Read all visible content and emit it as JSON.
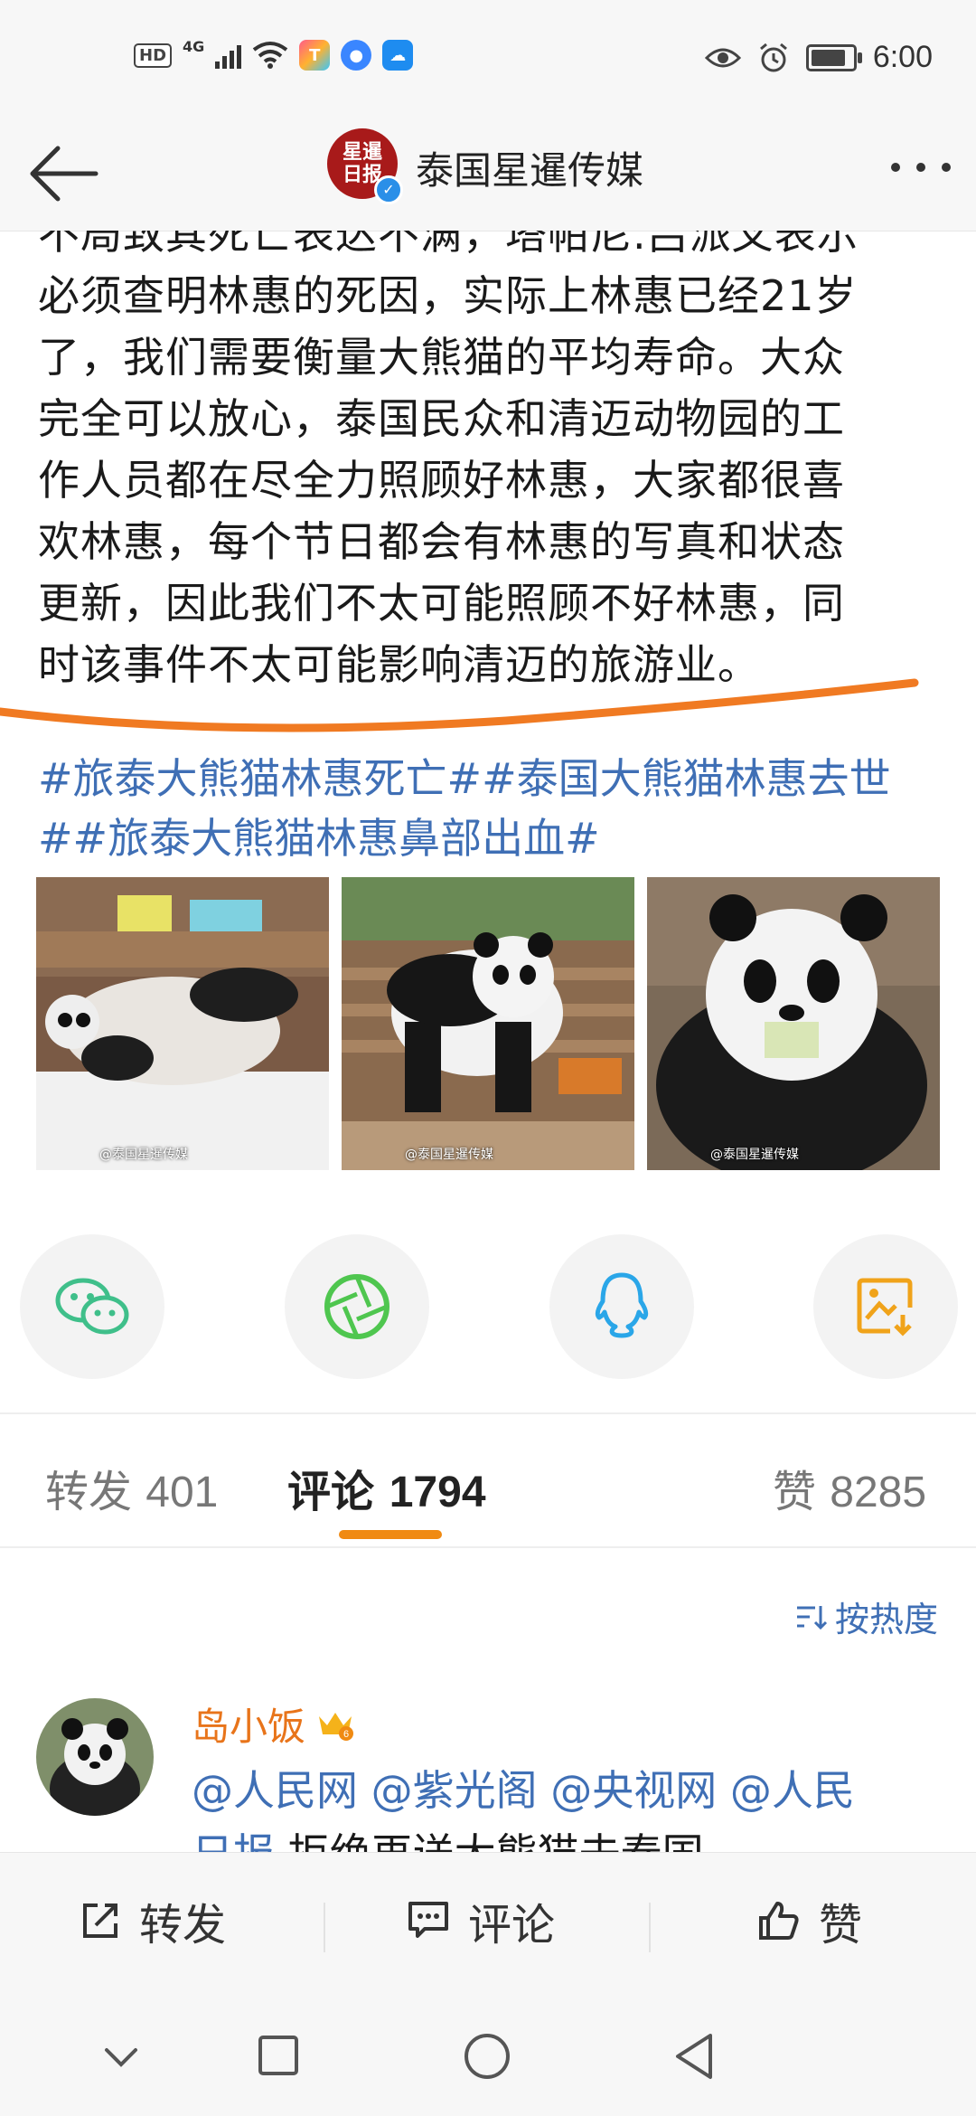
{
  "status_bar": {
    "hd_label": "HD",
    "network_label": "4G",
    "time": "6:00",
    "battery_level_pct": 85,
    "icons": [
      "signal-icon",
      "wifi-icon",
      "app-notification-icon",
      "browser-icon",
      "weather-icon",
      "eye-icon",
      "alarm-icon",
      "battery-icon"
    ]
  },
  "header": {
    "account_name": "泰国星暹传媒",
    "logo_text": "星暹日报",
    "icons": [
      "back-arrow-icon",
      "verified-icon",
      "more-icon"
    ]
  },
  "post": {
    "lines": [
      "不局致其死亡表达不满，塔帕尼.吕派叉表示",
      "必须查明林惠的死因，实际上林惠已经21岁",
      "了，我们需要衡量大熊猫的平均寿命。大众",
      "完全可以放心，泰国民众和清迈动物园的工",
      "作人员都在尽全力照顾好林惠，大家都很喜",
      "欢林惠，每个节日都会有林惠的写真和状态",
      "更新，因此我们不太可能照顾不好林惠，同",
      "时该事件不太可能影响清迈的旅游业。"
    ],
    "hashtags": "#旅泰大熊猫林惠死亡##泰国大熊猫林惠去世##旅泰大熊猫林惠鼻部出血#",
    "photo_watermarks": [
      "@泰国星暹传媒",
      "@泰国星暹传媒",
      "@泰国星暹传媒"
    ]
  },
  "share_targets": [
    "wechat-icon",
    "moments-icon",
    "qq-icon",
    "save-image-icon"
  ],
  "tabs": [
    {
      "label": "转发",
      "count": "401"
    },
    {
      "label": "评论",
      "count": "1794"
    },
    {
      "label": "赞",
      "count": "8285"
    }
  ],
  "sort_label": "按热度",
  "comment": {
    "username": "岛小饭",
    "badge_number": "6",
    "mentions": [
      "@人民网",
      "@紫光阁",
      "@央视网",
      "@人民"
    ],
    "line2_mention": "日报",
    "line2_text": " 拒绝再送大熊猫去泰国"
  },
  "action_bar": {
    "repost_label": "转发",
    "comment_label": "评论",
    "like_label": "赞"
  },
  "colors": {
    "link": "#3f6fb5",
    "accent_orange": "#f08a12",
    "username_orange": "#e8741a"
  }
}
